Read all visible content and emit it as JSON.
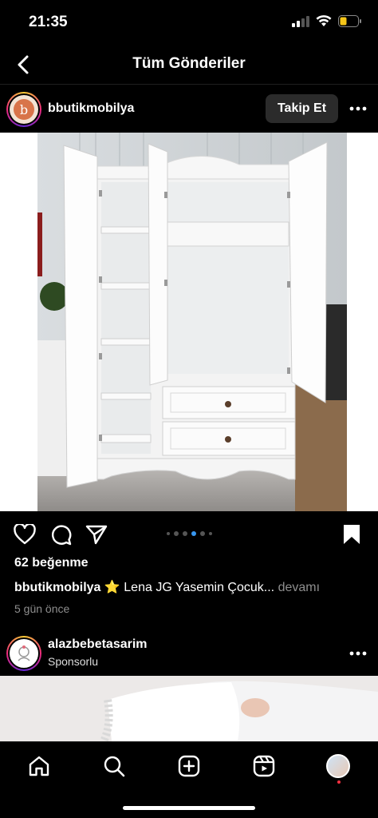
{
  "status_bar": {
    "time": "21:35"
  },
  "nav": {
    "title": "Tüm Gönderiler"
  },
  "post": {
    "username": "bbutikmobilya",
    "avatar_letter": "b",
    "follow_label": "Takip Et",
    "image_count": 6,
    "active_image_index": 3,
    "likes": "62 beğenme",
    "caption_user": "bbutikmobilya",
    "caption_emoji": "⭐",
    "caption_text": "Lena JG Yasemin Çocuk...",
    "caption_more": "devamı",
    "time_ago": "5 gün önce"
  },
  "sponsored_post": {
    "username": "alazbebetasarim",
    "subtitle": "Sponsorlu"
  },
  "tab_bar": {
    "items": [
      "home-icon",
      "search-icon",
      "create-icon",
      "reels-icon",
      "profile-avatar"
    ]
  },
  "colors": {
    "background": "#000000",
    "accent_blue": "#3897f0",
    "follow_button": "#2b2b2b",
    "muted_text": "#8e8e8e",
    "notification_dot": "#ff3040",
    "battery": "#f5c518"
  }
}
